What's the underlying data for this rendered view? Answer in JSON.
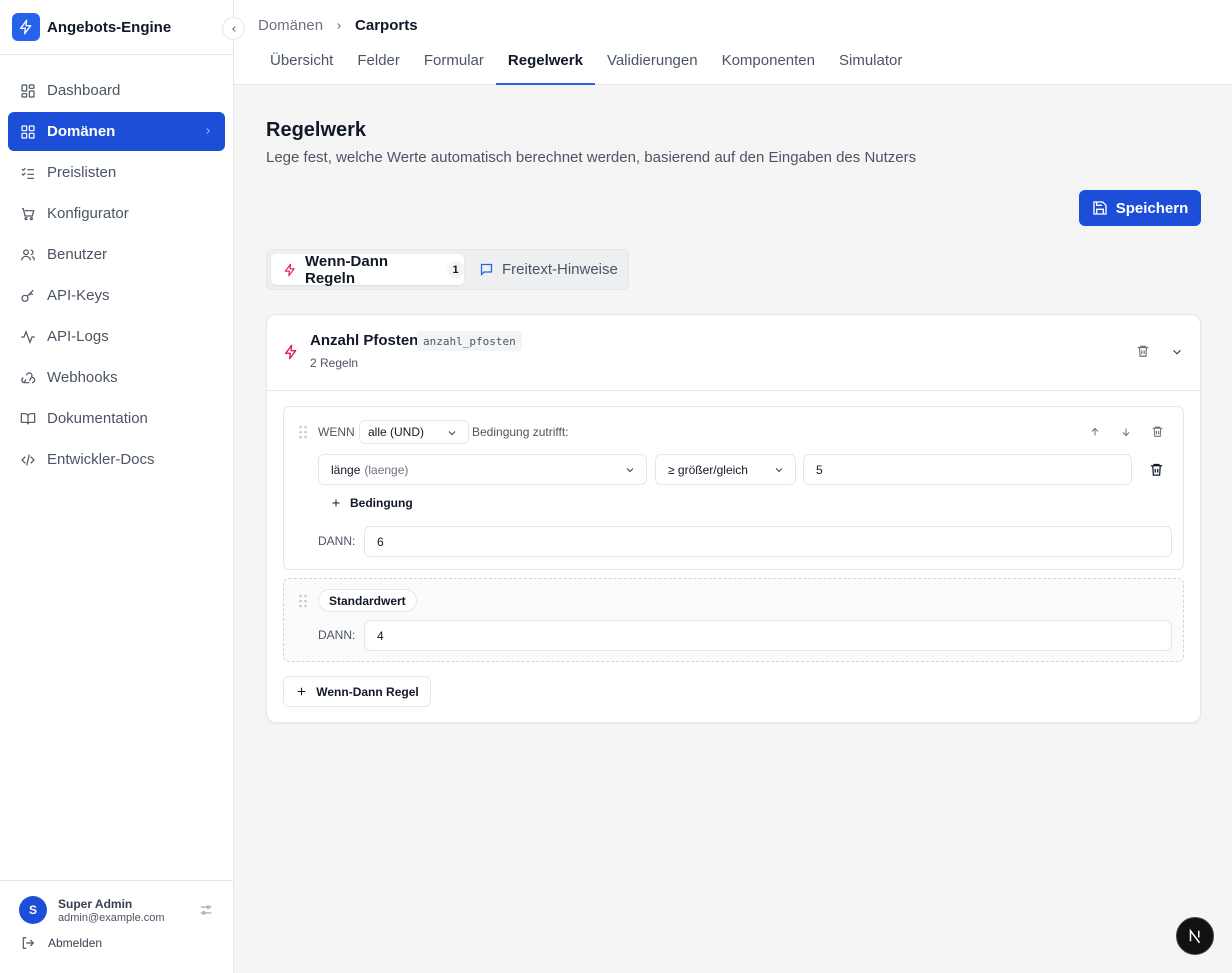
{
  "brand": {
    "title": "Angebots-Engine",
    "logo_icon": "lightning-icon",
    "accent": "#2563eb"
  },
  "sidebar": {
    "items": [
      {
        "label": "Dashboard",
        "icon": "dashboard-icon"
      },
      {
        "label": "Domänen",
        "icon": "grid-icon",
        "active": true
      },
      {
        "label": "Preislisten",
        "icon": "list-check-icon"
      },
      {
        "label": "Konfigurator",
        "icon": "cart-icon"
      },
      {
        "label": "Benutzer",
        "icon": "users-icon"
      },
      {
        "label": "API-Keys",
        "icon": "key-icon"
      },
      {
        "label": "API-Logs",
        "icon": "activity-icon"
      },
      {
        "label": "Webhooks",
        "icon": "webhook-icon"
      },
      {
        "label": "Dokumentation",
        "icon": "book-icon"
      },
      {
        "label": "Entwickler-Docs",
        "icon": "code-icon"
      }
    ],
    "user": {
      "initial": "S",
      "name": "Super Admin",
      "email": "admin@example.com"
    },
    "logout_label": "Abmelden"
  },
  "header": {
    "breadcrumb": {
      "parent": "Domänen",
      "current": "Carports"
    },
    "tabs": [
      {
        "label": "Übersicht"
      },
      {
        "label": "Felder"
      },
      {
        "label": "Formular"
      },
      {
        "label": "Regelwerk",
        "active": true
      },
      {
        "label": "Validierungen"
      },
      {
        "label": "Komponenten"
      },
      {
        "label": "Simulator"
      }
    ]
  },
  "main": {
    "title": "Regelwerk",
    "subtitle": "Lege fest, welche Werte automatisch berechnet werden, basierend auf den Eingaben des Nutzers",
    "save_label": "Speichern",
    "segments": {
      "rules_label": "Wenn-Dann Regeln",
      "rules_count": "1",
      "hints_label": "Freitext-Hinweise"
    },
    "field": {
      "name": "Anzahl Pfosten",
      "key": "anzahl_pfosten",
      "rule_count": "2 Regeln",
      "rule1": {
        "if_label": "WENN",
        "logic_value": "alle (UND)",
        "condition_suffix": "Bedingung zutrifft:",
        "condition": {
          "field": "länge",
          "field_key": "(laenge)",
          "operator": "≥ größer/gleich",
          "value": "5"
        },
        "add_condition_label": "Bedingung",
        "then_label": "DANN:",
        "then_value": "6"
      },
      "rule2": {
        "pill_label": "Standardwert",
        "then_label": "DANN:",
        "then_value": "4"
      },
      "add_rule_label": "Wenn-Dann Regel"
    }
  }
}
